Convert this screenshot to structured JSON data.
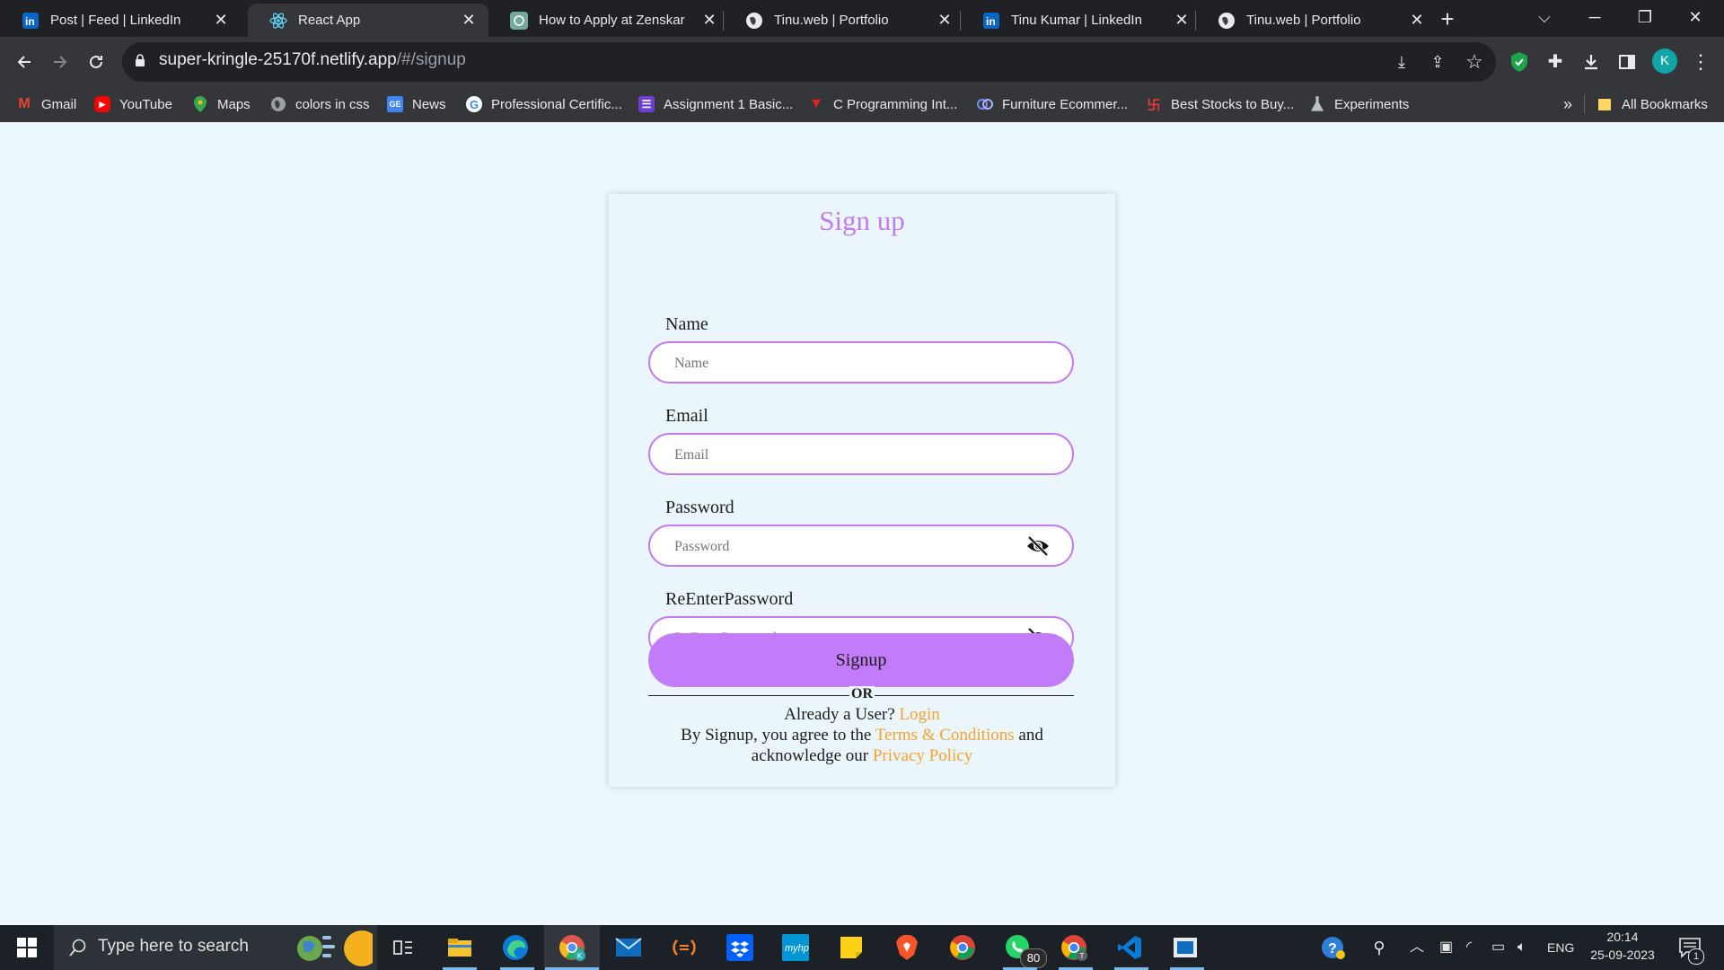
{
  "browser": {
    "tabs": [
      {
        "title": "Post | Feed | LinkedIn",
        "icon": "linkedin-icon",
        "active": false
      },
      {
        "title": "React App",
        "icon": "react-icon",
        "active": true
      },
      {
        "title": "How to Apply at Zenskar",
        "icon": "chatgpt-icon",
        "active": false
      },
      {
        "title": "Tinu.web | Portfolio",
        "icon": "globe-icon",
        "active": false
      },
      {
        "title": "Tinu Kumar | LinkedIn",
        "icon": "linkedin-icon",
        "active": false
      },
      {
        "title": "Tinu.web | Portfolio",
        "icon": "globe-icon",
        "active": false
      }
    ],
    "url_host": "super-kringle-25170f.netlify.app",
    "url_path": "/#/signup",
    "profile_initial": "K",
    "bookmarks": [
      {
        "label": "Gmail",
        "icon": "gmail-icon"
      },
      {
        "label": "YouTube",
        "icon": "youtube-icon"
      },
      {
        "label": "Maps",
        "icon": "maps-icon"
      },
      {
        "label": "colors in css",
        "icon": "globe-icon"
      },
      {
        "label": "News",
        "icon": "news-icon"
      },
      {
        "label": "Professional Certific...",
        "icon": "google-icon"
      },
      {
        "label": "Assignment 1 Basic...",
        "icon": "list-icon"
      },
      {
        "label": "C Programming Int...",
        "icon": "triangle-logo-icon"
      },
      {
        "label": "Furniture Ecommer...",
        "icon": "ring-logo-icon"
      },
      {
        "label": "Best Stocks to Buy...",
        "icon": "swastik-logo-icon"
      },
      {
        "label": "Experiments",
        "icon": "flask-icon"
      }
    ],
    "all_bookmarks": "All Bookmarks",
    "overflow": "»"
  },
  "signup": {
    "title": "Sign up",
    "name_label": "Name",
    "name_placeholder": "Name",
    "email_label": "Email",
    "email_placeholder": "Email",
    "password_label": "Password",
    "password_placeholder": "Password",
    "reenter_label": "ReEnterPassword",
    "reenter_placeholder": "ReEnterPassword",
    "submit": "Signup",
    "or": "OR",
    "already_text": "Already a User?",
    "login_link": "Login",
    "agree_prefix": "By Signup, you agree to the",
    "terms_link": "Terms & Conditions",
    "agree_and": "and",
    "acknowledge": "acknowledge our",
    "privacy_link": "Privacy Policy",
    "colors": {
      "accent": "#c27cf0",
      "button": "#c27cf9",
      "link": "#f3a233",
      "background": "#edf8fd"
    }
  },
  "taskbar": {
    "search_placeholder": "Type here to search",
    "whatsapp_badge": "80",
    "language": "ENG",
    "time": "20:14",
    "date": "25-09-2023",
    "notification_count": "1"
  }
}
